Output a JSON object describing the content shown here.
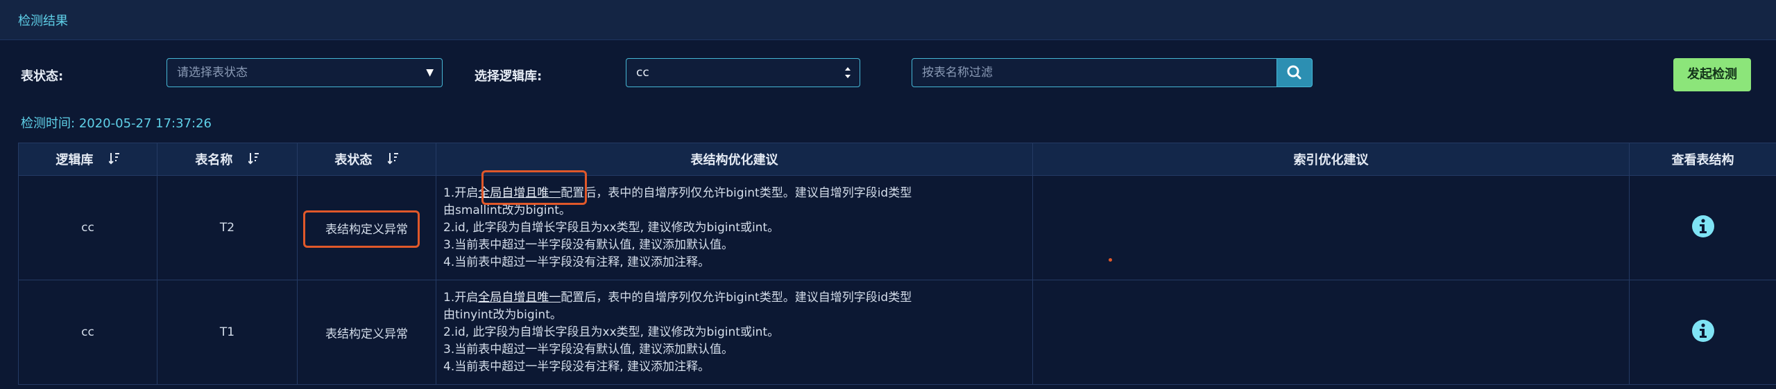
{
  "header": {
    "title": "检测结果"
  },
  "filters": {
    "status_label": "表状态:",
    "status_placeholder": "请选择表状态",
    "db_label": "选择逻辑库:",
    "db_value": "cc",
    "search_placeholder": "按表名称过滤"
  },
  "action": {
    "start_label": "发起检测"
  },
  "check_time": {
    "label": "检测时间:",
    "value": "2020-05-27 17:37:26"
  },
  "table": {
    "columns": [
      "逻辑库",
      "表名称",
      "表状态",
      "表结构优化建议",
      "索引优化建议",
      "查看表结构"
    ],
    "rows": [
      {
        "db": "cc",
        "name": "T2",
        "status": "表结构定义异常",
        "suggestions": {
          "l1_pre": "1.开启",
          "l1_link": "全局自增且唯一",
          "l1_post": "配置后，表中的自增序列仅允许bigint类型。建议自增列字段id类型",
          "l1_cont": "由smallint改为bigint。",
          "l2": "2.id, 此字段为自增长字段且为xx类型, 建议修改为bigint或int。",
          "l3": "3.当前表中超过一半字段没有默认值, 建议添加默认值。",
          "l4": "4.当前表中超过一半字段没有注释, 建议添加注释。"
        },
        "index_suggestion": ""
      },
      {
        "db": "cc",
        "name": "T1",
        "status": "表结构定义异常",
        "suggestions": {
          "l1_pre": "1.开启",
          "l1_link": "全局自增且唯一",
          "l1_post": "配置后，表中的自增序列仅允许bigint类型。建议自增列字段id类型",
          "l1_cont": "由tinyint改为bigint。",
          "l2": "2.id, 此字段为自增长字段且为xx类型, 建议修改为bigint或int。",
          "l3": "3.当前表中超过一半字段没有默认值, 建议添加默认值。",
          "l4": "4.当前表中超过一半字段没有注释, 建议添加注释。"
        },
        "index_suggestion": ""
      }
    ]
  },
  "colors": {
    "accent": "#5fd0e8",
    "highlight_box": "#e0582a",
    "button_green": "#8ce57a"
  },
  "icons": [
    "sort-icon",
    "search-icon",
    "info-icon",
    "caret-down-icon",
    "up-down-caret-icon"
  ]
}
